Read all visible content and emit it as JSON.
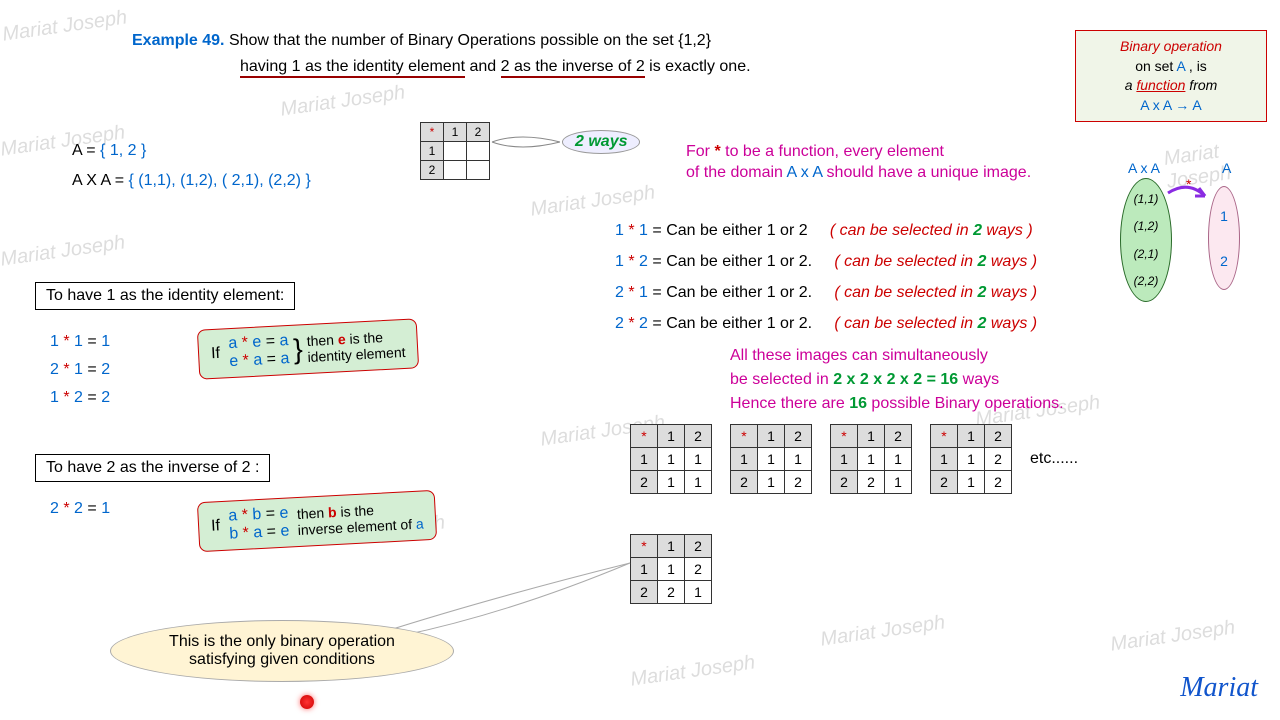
{
  "title": {
    "label": "Example 49.",
    "text1": "Show that the number of Binary Operations possible on the set  {1,2}",
    "text2a": "having 1  as the identity element",
    "text2b": " and ",
    "text2c": "2 as the inverse of 2",
    "text2d": " is exactly one."
  },
  "definBox": {
    "l1": "Binary operation",
    "l2a": "on set ",
    "l2b": "A",
    "l2c": " , is",
    "l3a": "a ",
    "l3b": "function",
    "l3c": "  from",
    "l4": "A x A → A"
  },
  "setA": {
    "lhs": "A = ",
    "set": "{ 1, 2 }"
  },
  "axA": {
    "lhs": "A X A = ",
    "set": "{ (1,1), (1,2), ( 2,1), (2,2) }"
  },
  "callout": "2 ways",
  "smallTable": {
    "corner": "*",
    "h1": "1",
    "h2": "2"
  },
  "funcText": {
    "l1a": "For  ",
    "l1b": "*",
    "l1c": "   to be  a function,   every element",
    "l2a": "of the domain ",
    "l2b": "A x A",
    "l2c": "  should have a unique image."
  },
  "mapLabels": {
    "top": "A x A",
    "mid": "*",
    "right": "A"
  },
  "domainItems": [
    "(1,1)",
    "(1,2)",
    "(2,1)",
    "(2,2)"
  ],
  "codomain": [
    "1",
    "2"
  ],
  "combos": [
    {
      "lhs1": "1",
      "op": "*",
      "lhs2": "1",
      "eq": "=",
      "rhs": "Can be either 1 or 2",
      "note": "( can be selected in ",
      "two": "2",
      "ways": " ways )"
    },
    {
      "lhs1": "1",
      "op": "*",
      "lhs2": "2",
      "eq": "=",
      "rhs": "Can be either 1 or 2.",
      "note": "( can be selected in ",
      "two": "2",
      "ways": " ways )"
    },
    {
      "lhs1": "2",
      "op": "*",
      "lhs2": "1",
      "eq": "=",
      "rhs": "Can be either 1 or 2.",
      "note": "( can be selected in ",
      "two": "2",
      "ways": " ways )"
    },
    {
      "lhs1": "2",
      "op": "*",
      "lhs2": "2",
      "eq": "=",
      "rhs": "Can be either 1 or 2.",
      "note": "( can be selected in ",
      "two": "2",
      "ways": " ways )"
    }
  ],
  "selectText": {
    "l1": "All these images can simultaneously",
    "l2a": "be selected in  ",
    "l2b": "2 x 2 x 2 x 2 = 16",
    "l2c": "  ways",
    "l3a": "Hence  there  are  ",
    "l3b": "16",
    "l3c": "  possible Binary operations."
  },
  "idHeader": "To have 1 as  the identity element:",
  "idEqs": [
    "1 * 1  = 1",
    "2 * 1  = 2",
    "1 * 2  = 2"
  ],
  "idBox": {
    "pre": "If",
    "l1": "a * e  = a",
    "l2": "e * a  = a",
    "note": "then e is the identity element"
  },
  "invHeader": "To have 2 as  the inverse of 2 :",
  "invEq": "2 * 2  = 1",
  "invBox": {
    "pre": "If",
    "l1": "a * b  = e",
    "l2": "b * a  = e",
    "note": "then b is the inverse element of a"
  },
  "tables": [
    {
      "r1": [
        "1",
        "1"
      ],
      "r2": [
        "1",
        "1"
      ]
    },
    {
      "r1": [
        "1",
        "1"
      ],
      "r2": [
        "1",
        "2"
      ]
    },
    {
      "r1": [
        "1",
        "1"
      ],
      "r2": [
        "2",
        "1"
      ]
    },
    {
      "r1": [
        "1",
        "2"
      ],
      "r2": [
        "1",
        "2"
      ]
    }
  ],
  "etc": "etc......",
  "finalTable": {
    "r1": [
      "1",
      "2"
    ],
    "r2": [
      "2",
      "1"
    ]
  },
  "speech": {
    "l1": "This is the only binary operation",
    "l2": "satisfying given conditions"
  },
  "sig": "Mariat",
  "wm": "Mariat Joseph"
}
